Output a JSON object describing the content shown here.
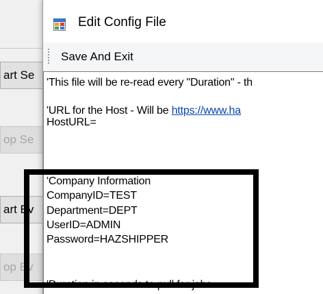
{
  "background_window": {
    "buttons": [
      {
        "label": "art Se",
        "state": "normal"
      },
      {
        "label": "op Se",
        "state": "disabled"
      },
      {
        "label": "art Ev",
        "state": "normal"
      },
      {
        "label": "op Ev",
        "state": "disabled"
      }
    ]
  },
  "dialog": {
    "title": "Edit Config File",
    "icon": "application-window-icon",
    "menu": {
      "save_and_exit": "Save And Exit"
    }
  },
  "editor": {
    "lines": [
      "'This file will be re-read every \"Duration\" - th",
      "",
      "'URL for the Host - Will be ",
      "HostURL=",
      "",
      "'Company Information",
      "CompanyID=TEST",
      "Department=DEPT",
      "UserID=ADMIN",
      "Password=HAZSHIPPER",
      "",
      "'Duration in seconds to pull for jobs"
    ],
    "url_link_text": "https://www.ha"
  },
  "annotation": {
    "color": "#000000"
  },
  "colors": {
    "link": "#0645ad",
    "window_bg": "#f0f0f0",
    "menubar_bg": "#f5f6f7"
  }
}
